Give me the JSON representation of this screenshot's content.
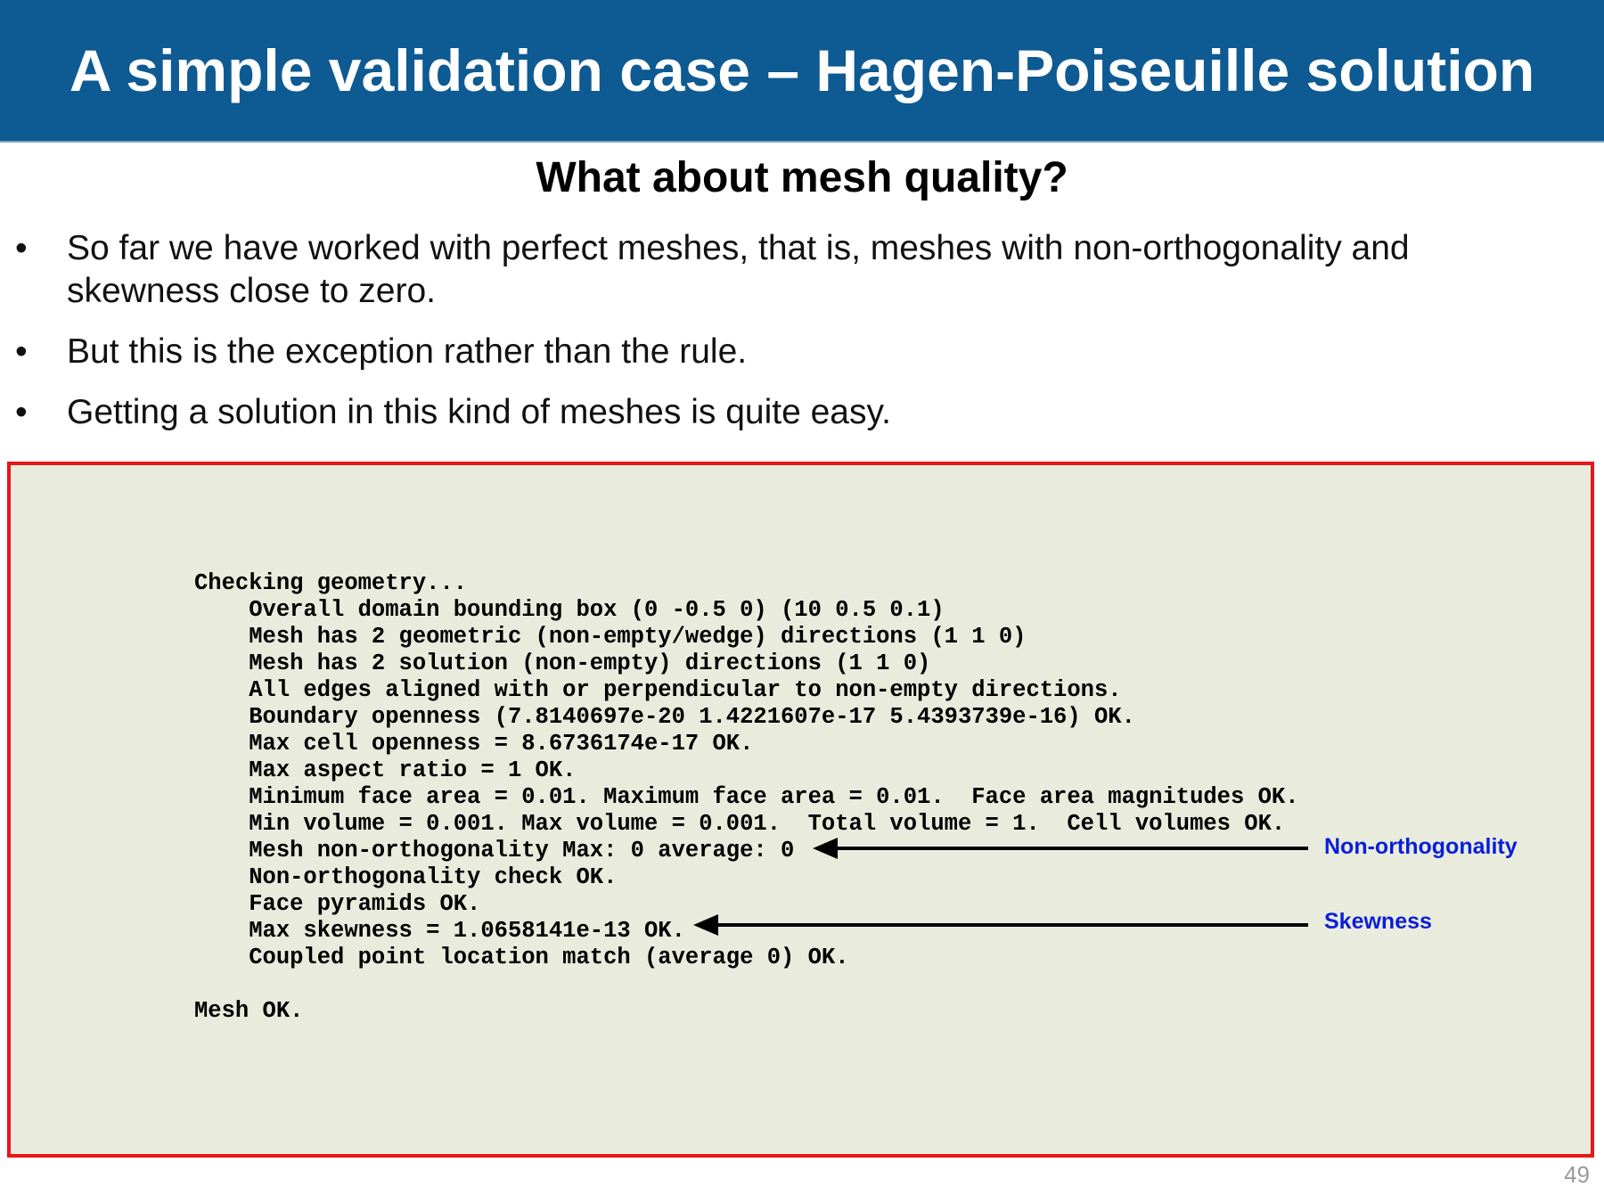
{
  "header": {
    "title": "A simple validation case – Hagen-Poiseuille solution",
    "background_color": "#0e5a92"
  },
  "subtitle": "What about mesh quality?",
  "bullets": [
    {
      "marker": "•",
      "text": "So far we have worked with perfect meshes, that is, meshes with non-orthogonality and skewness close to zero."
    },
    {
      "marker": "•",
      "text": "But this is the exception rather than the rule."
    },
    {
      "marker": "•",
      "text": "Getting a solution in this kind of meshes is quite easy."
    }
  ],
  "terminal": {
    "background_color": "#e9ecdd",
    "border_color": "#e8151a",
    "lines": [
      "Checking geometry...",
      "    Overall domain bounding box (0 -0.5 0) (10 0.5 0.1)",
      "    Mesh has 2 geometric (non-empty/wedge) directions (1 1 0)",
      "    Mesh has 2 solution (non-empty) directions (1 1 0)",
      "    All edges aligned with or perpendicular to non-empty directions.",
      "    Boundary openness (7.8140697e-20 1.4221607e-17 5.4393739e-16) OK.",
      "    Max cell openness = 8.6736174e-17 OK.",
      "    Max aspect ratio = 1 OK.",
      "    Minimum face area = 0.01. Maximum face area = 0.01.  Face area magnitudes OK.",
      "    Min volume = 0.001. Max volume = 0.001.  Total volume = 1.  Cell volumes OK.",
      "    Mesh non-orthogonality Max: 0 average: 0",
      "    Non-orthogonality check OK.",
      "    Face pyramids OK.",
      "    Max skewness = 1.0658141e-13 OK.",
      "    Coupled point location match (average 0) OK.",
      "",
      "Mesh OK."
    ]
  },
  "annotations": {
    "non_orthogonality": "Non-orthogonality",
    "skewness": "Skewness",
    "color": "#0a1ed8"
  },
  "page_number": "49"
}
